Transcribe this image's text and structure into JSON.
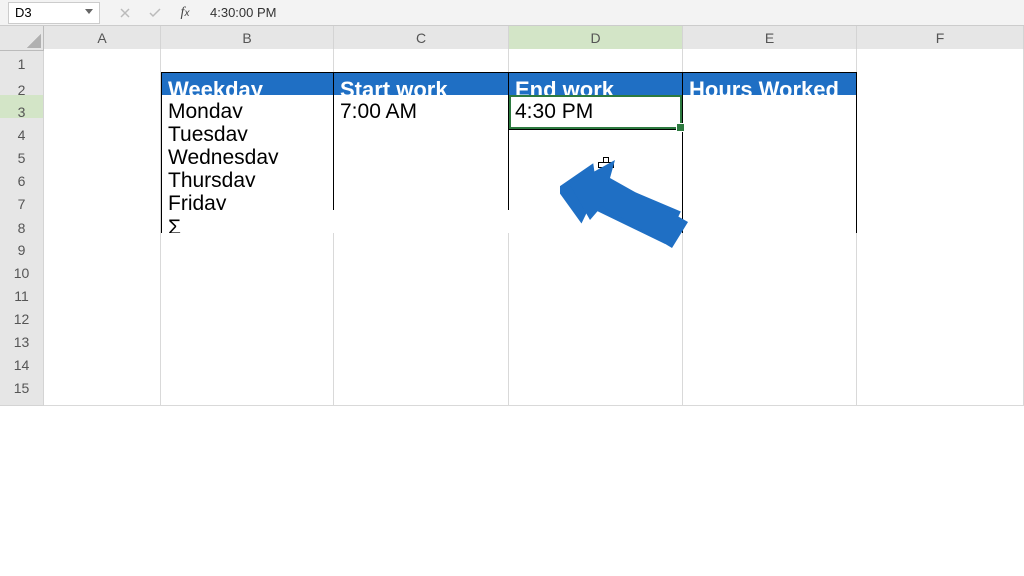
{
  "formula_bar": {
    "cell_ref": "D3",
    "value": "4:30:00 PM"
  },
  "columns": [
    "A",
    "B",
    "C",
    "D",
    "E",
    "F"
  ],
  "rows": [
    "1",
    "2",
    "3",
    "4",
    "5",
    "6",
    "7",
    "8",
    "9",
    "10",
    "11",
    "12",
    "13",
    "14",
    "15"
  ],
  "table": {
    "headers": [
      "Weekday",
      "Start work",
      "End work",
      "Hours Worked"
    ],
    "days": [
      "Monday",
      "Tuesday",
      "Wednesday",
      "Thursday",
      "Friday"
    ],
    "sum_label": "Σ",
    "start_values": [
      "7:00 AM",
      "",
      "",
      "",
      ""
    ],
    "end_values": [
      "4:30 PM",
      "",
      "",
      "",
      ""
    ],
    "hours_values": [
      "",
      "",
      "",
      "",
      ""
    ]
  },
  "active": {
    "col": "D",
    "row": "3"
  },
  "chart_data": {
    "type": "table",
    "title": "",
    "columns": [
      "Weekday",
      "Start work",
      "End work",
      "Hours Worked"
    ],
    "rows": [
      {
        "Weekday": "Monday",
        "Start work": "7:00 AM",
        "End work": "4:30 PM",
        "Hours Worked": ""
      },
      {
        "Weekday": "Tuesday",
        "Start work": "",
        "End work": "",
        "Hours Worked": ""
      },
      {
        "Weekday": "Wednesday",
        "Start work": "",
        "End work": "",
        "Hours Worked": ""
      },
      {
        "Weekday": "Thursday",
        "Start work": "",
        "End work": "",
        "Hours Worked": ""
      },
      {
        "Weekday": "Friday",
        "Start work": "",
        "End work": "",
        "Hours Worked": ""
      }
    ]
  }
}
